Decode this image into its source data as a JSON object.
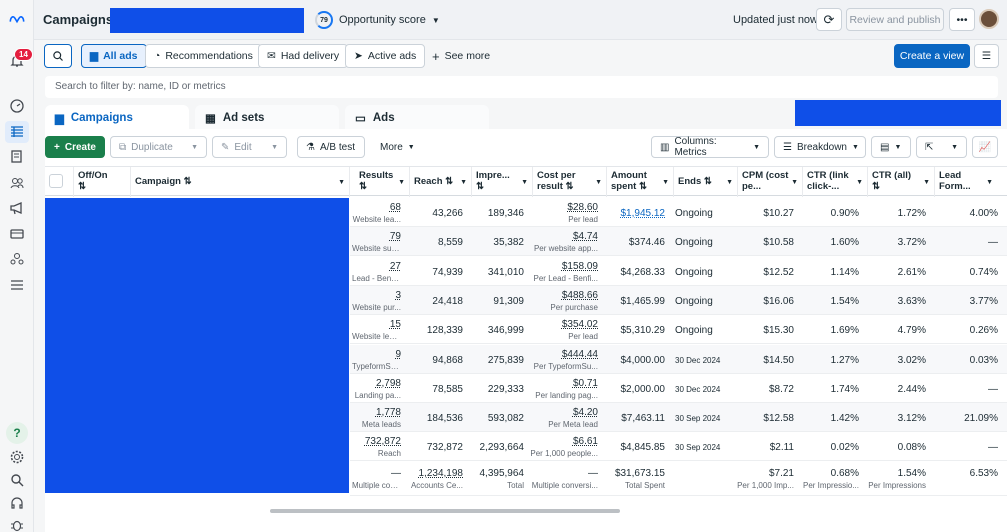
{
  "header": {
    "title": "Campaigns",
    "opportunity_score_value": "79",
    "opportunity_score_label": "Opportunity score",
    "updated": "Updated just now",
    "review_publish": "Review and publish",
    "more": "•••"
  },
  "notifications_badge": "14",
  "filters": {
    "all_ads": "All ads",
    "recommendations": "Recommendations",
    "had_delivery": "Had delivery",
    "active_ads": "Active ads",
    "see_more": "See more",
    "create_view": "Create a view"
  },
  "search": {
    "placeholder": "Search to filter by: name, ID or metrics"
  },
  "level_tabs": {
    "campaigns": "Campaigns",
    "ad_sets": "Ad sets",
    "ads": "Ads"
  },
  "toolbar": {
    "create": "Create",
    "duplicate": "Duplicate",
    "edit": "Edit",
    "ab_test": "A/B test",
    "more": "More",
    "columns": "Columns: Metrics",
    "breakdown": "Breakdown"
  },
  "columns": {
    "off_on": "Off/On",
    "campaign": "Campaign",
    "results": "Results",
    "reach": "Reach",
    "impressions": "Impre...",
    "cost_per_result": "Cost per result",
    "amount_spent": "Amount spent",
    "ends": "Ends",
    "cpm": "CPM (cost pe...",
    "ctr_link": "CTR (link click-...",
    "ctr_all": "CTR (all)",
    "lead_form": "Lead Form..."
  },
  "rows": [
    {
      "results": "68",
      "results_sub": "Website lea...",
      "reach": "43,266",
      "impr": "189,346",
      "cpr": "$28.60",
      "cpr_sub": "Per lead",
      "spent": "$1,945.12",
      "ends": "Ongoing",
      "cpm": "$10.27",
      "ctr_link": "0.90%",
      "ctr_all": "1.72%",
      "lead": "4.00%"
    },
    {
      "results": "79",
      "results_sub": "Website sub...",
      "reach": "8,559",
      "impr": "35,382",
      "cpr": "$4.74",
      "cpr_sub": "Per website app...",
      "spent": "$374.46",
      "ends": "Ongoing",
      "cpm": "$10.58",
      "ctr_link": "1.60%",
      "ctr_all": "3.72%",
      "lead": "—"
    },
    {
      "results": "27",
      "results_sub": "Lead - Benfi...",
      "reach": "74,939",
      "impr": "341,010",
      "cpr": "$158.09",
      "cpr_sub": "Per Lead - Benfi...",
      "spent": "$4,268.33",
      "ends": "Ongoing",
      "cpm": "$12.52",
      "ctr_link": "1.14%",
      "ctr_all": "2.61%",
      "lead": "0.74%"
    },
    {
      "results": "3",
      "results_sub": "Website pur...",
      "reach": "24,418",
      "impr": "91,309",
      "cpr": "$488.66",
      "cpr_sub": "Per purchase",
      "spent": "$1,465.99",
      "ends": "Ongoing",
      "cpm": "$16.06",
      "ctr_link": "1.54%",
      "ctr_all": "3.63%",
      "lead": "3.77%"
    },
    {
      "results": "15",
      "results_sub": "Website leads",
      "reach": "128,339",
      "impr": "346,999",
      "cpr": "$354.02",
      "cpr_sub": "Per lead",
      "spent": "$5,310.29",
      "ends": "Ongoing",
      "cpm": "$15.30",
      "ctr_link": "1.69%",
      "ctr_all": "4.79%",
      "lead": "0.26%"
    },
    {
      "results": "9",
      "results_sub": "TypeformSu...",
      "reach": "94,868",
      "impr": "275,839",
      "cpr": "$444.44",
      "cpr_sub": "Per TypeformSu...",
      "spent": "$4,000.00",
      "ends": "30 Dec 2024",
      "cpm": "$14.50",
      "ctr_link": "1.27%",
      "ctr_all": "3.02%",
      "lead": "0.03%"
    },
    {
      "results": "2,798",
      "results_sub": "Landing pa...",
      "reach": "78,585",
      "impr": "229,333",
      "cpr": "$0.71",
      "cpr_sub": "Per landing pag...",
      "spent": "$2,000.00",
      "ends": "30 Dec 2024",
      "cpm": "$8.72",
      "ctr_link": "1.74%",
      "ctr_all": "2.44%",
      "lead": "—"
    },
    {
      "results": "1,778",
      "results_sub": "Meta leads",
      "reach": "184,536",
      "impr": "593,082",
      "cpr": "$4.20",
      "cpr_sub": "Per Meta lead",
      "spent": "$7,463.11",
      "ends": "30 Sep 2024",
      "cpm": "$12.58",
      "ctr_link": "1.42%",
      "ctr_all": "3.12%",
      "lead": "21.09%"
    },
    {
      "results": "732,872",
      "results_sub": "Reach",
      "reach": "732,872",
      "impr": "2,293,664",
      "cpr": "$6.61",
      "cpr_sub": "Per 1,000 people...",
      "spent": "$4,845.85",
      "ends": "30 Sep 2024",
      "cpm": "$2.11",
      "ctr_link": "0.02%",
      "ctr_all": "0.08%",
      "lead": "—"
    }
  ],
  "totals": {
    "results": "—",
    "results_sub": "Multiple con...",
    "reach": "1,234,198",
    "reach_sub": "Accounts Ce...",
    "impr": "4,395,964",
    "impr_sub": "Total",
    "cpr": "—",
    "cpr_sub": "Multiple conversi...",
    "spent": "$31,673.15",
    "spent_sub": "Total Spent",
    "cpm": "$7.21",
    "cpm_sub": "Per 1,000 Imp...",
    "ctr_link": "0.68%",
    "ctr_link_sub": "Per Impressio...",
    "ctr_all": "1.54%",
    "ctr_all_sub": "Per Impressions",
    "lead": "6.53%"
  },
  "colors": {
    "accent": "#0a66c2",
    "create_green": "#1a7f4b",
    "redaction": "#0f4fe8"
  }
}
